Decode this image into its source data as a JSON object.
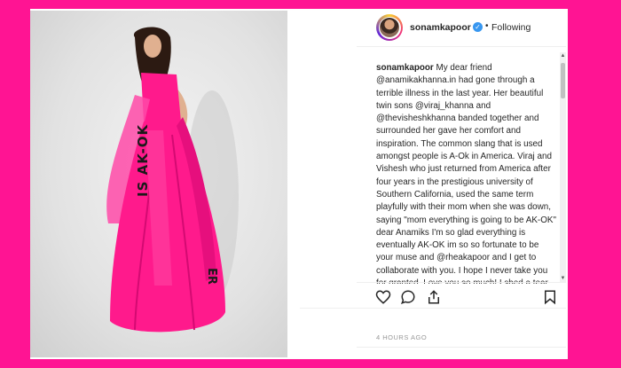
{
  "post": {
    "username": "sonamkapoor",
    "verified_mark": "✓",
    "separator": "•",
    "follow_status": "Following",
    "caption_user": "sonamkapoor",
    "caption_text": "My dear friend @anamikakhanna.in had gone through a terrible illness in the last year. Her beautiful twin sons @viraj_khanna and @thevisheshkhanna banded together and surrounded her gave her comfort and inspiration. The common slang that is used amongst people is A-Ok in America. Viraj and Vishesh who just returned from America after four years in the prestigious university of Southern California, used the same term playfully with their mom when she was down, saying \"mom everything is going to be AK-OK\" dear Anamiks I'm so glad everything is eventually AK-OK im so so fortunate to be your muse and @rheakapoor and I get to collaborate with you. I hope I never take you for granted. Love you so much! I shed a tear when I",
    "timestamp": "4 HOURS AGO"
  },
  "photo": {
    "skirt_text": "IS AK-OK",
    "dupatta_text": "ER"
  },
  "icons": {
    "like": "heart-icon",
    "comment": "comment-icon",
    "share": "share-icon",
    "save": "bookmark-icon"
  },
  "colors": {
    "background": "#ff1493",
    "outfit": "#ff1a8c",
    "verified": "#3897f0",
    "text": "#262626",
    "muted": "#999999"
  }
}
